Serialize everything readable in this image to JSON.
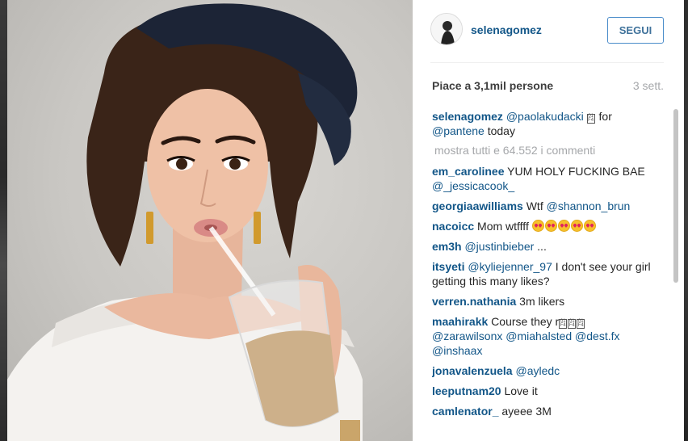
{
  "post": {
    "username": "selenagomez",
    "follow_label": "SEGUI",
    "likes_text": "Piace a 3,1mil persone",
    "time_ago": "3 sett.",
    "show_all_text": "mostra tutti e 64.552 i commenti"
  },
  "caption": {
    "user": "selenagomez",
    "mention": "@paolakudacki",
    "text1": "for",
    "mention2": "@pantene",
    "text2": "today"
  },
  "comments": [
    {
      "user": "em_carolinee",
      "text": "YUM HOLY FUCKING BAE",
      "mention": "@_jessicacook_"
    },
    {
      "user": "georgiaawilliams",
      "text": "Wtf",
      "mention": "@shannon_brun"
    },
    {
      "user": "nacoicc",
      "text": "Mom wtffff"
    },
    {
      "user": "em3h",
      "mention": "@justinbieber",
      "text": "..."
    },
    {
      "user": "itsyeti",
      "mention": "@kyliejenner_97",
      "text": "I don't see your girl getting this many likes?"
    },
    {
      "user": "verren.nathania",
      "text": "3m likers"
    },
    {
      "user": "maahirakk",
      "text": "Course they r",
      "mention": "@zarawilsonx @miahalsted @dest.fx",
      "mention2": "@inshaax"
    },
    {
      "user": "jonavalenzuela",
      "mention": "@ayledc"
    },
    {
      "user": "leeputnam20",
      "text": "Love it"
    },
    {
      "user": "camlenator_",
      "text": "ayeee 3M"
    }
  ],
  "icons": {
    "emoji": "heart-eyes-emoji",
    "unknown_glyph": "missing-glyph-box"
  },
  "colors": {
    "link": "#125688",
    "button": "#3f729b",
    "muted": "#a5a7aa"
  }
}
